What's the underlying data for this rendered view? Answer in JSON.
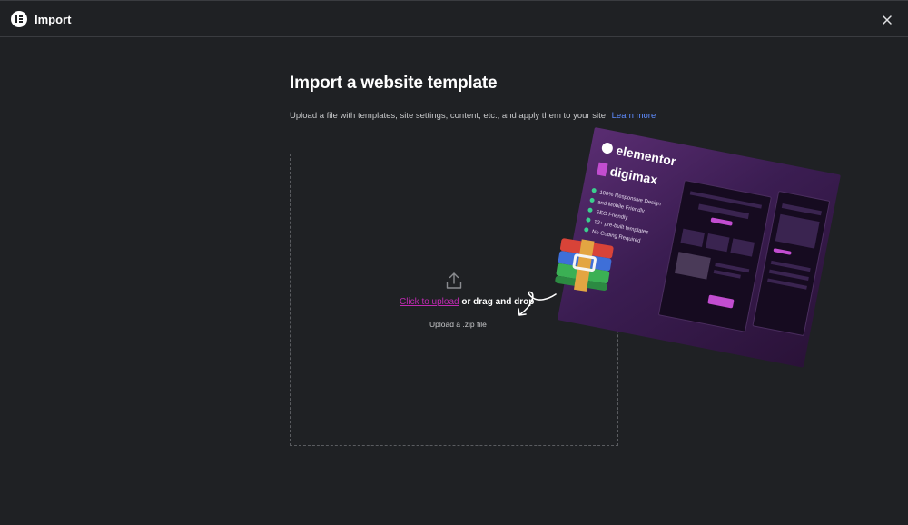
{
  "header": {
    "title": "Import",
    "logo_icon": "elementor-logo-icon",
    "close_icon": "close-icon"
  },
  "main": {
    "heading": "Import a website template",
    "subtitle": "Upload a file with templates, site settings, content, etc., and apply them to your site",
    "learn_more": "Learn more",
    "dropzone": {
      "icon": "upload-icon",
      "link_text": "Click to upload",
      "rest_text": " or drag and drop",
      "hint": "Upload a .zip file"
    }
  },
  "promo": {
    "logo_text": "elementor",
    "brand": "digimax",
    "features": [
      "100% Responsive Design",
      "and Mobile Friendly",
      "SEO Friendly",
      "12+ pre-built templates",
      "No Coding Required"
    ]
  },
  "colors": {
    "background": "#1f2124",
    "link_accent": "#c02ab3",
    "learn_more": "#5f8cff"
  }
}
